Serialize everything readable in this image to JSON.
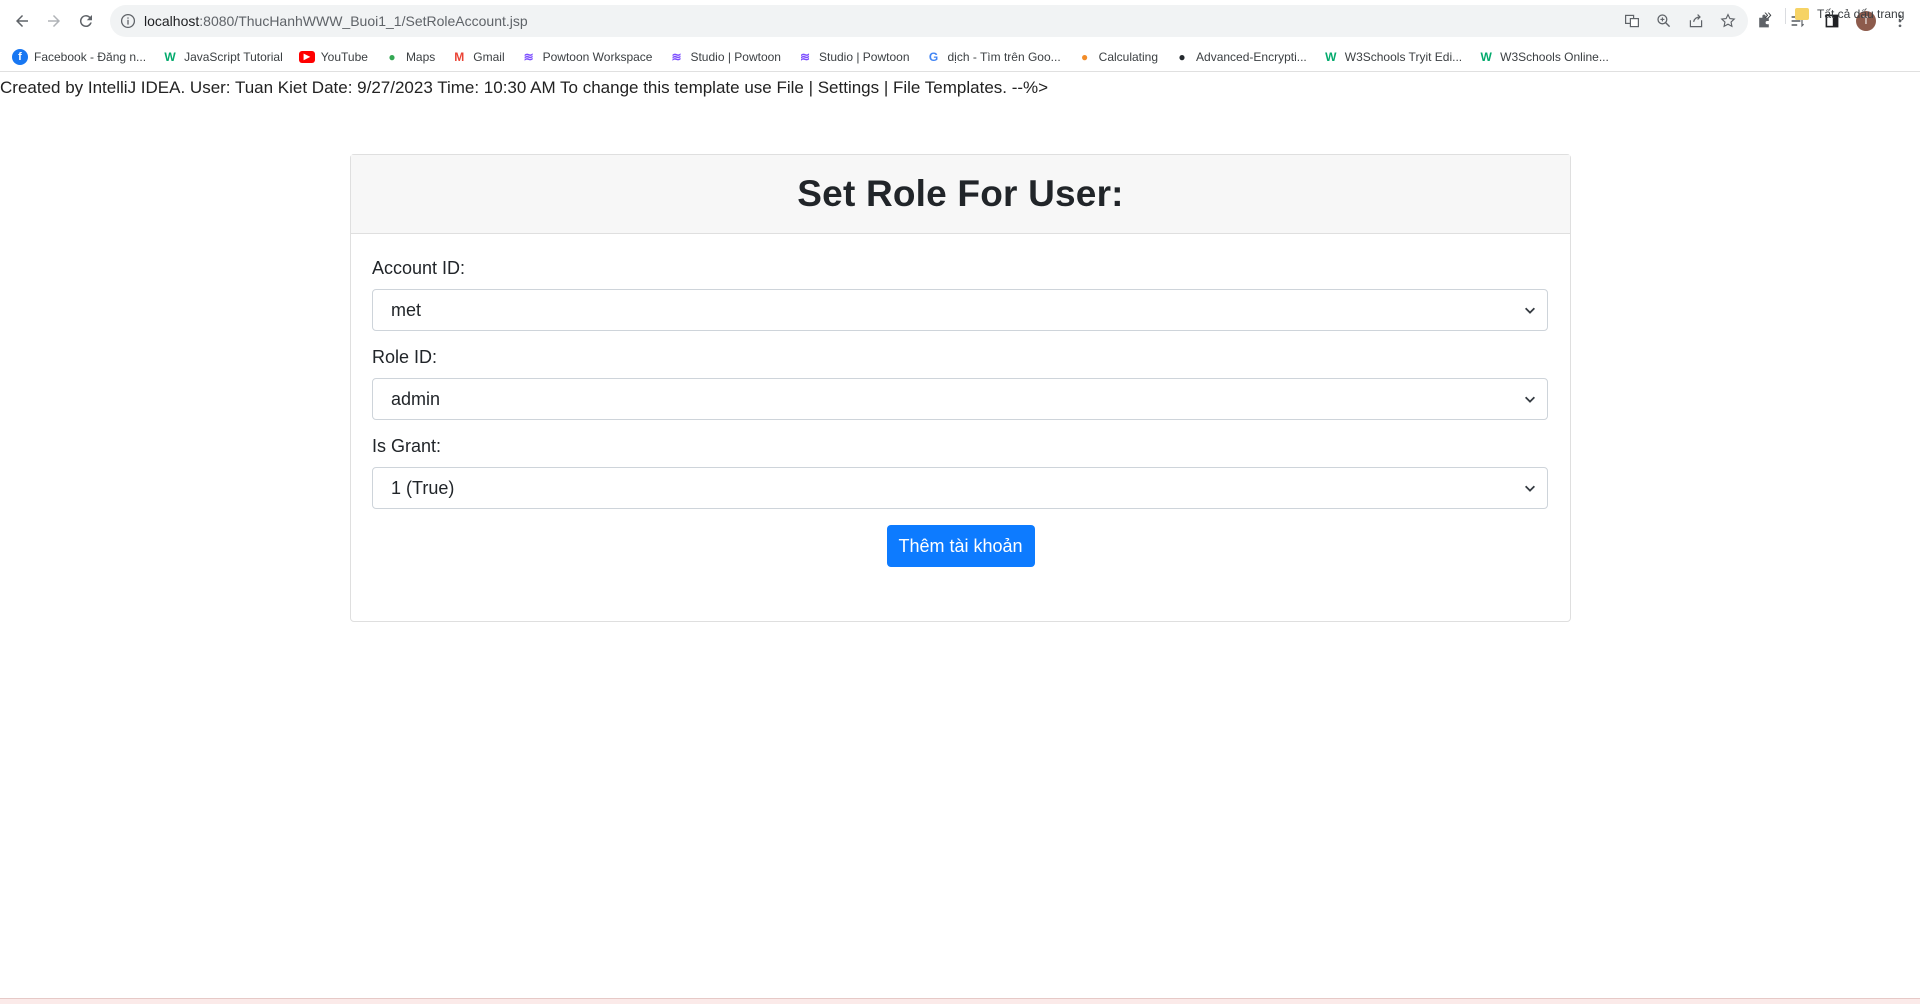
{
  "browser": {
    "url_host": "localhost",
    "url_rest": ":8080/ThucHanhWWW_Buoi1_1/SetRoleAccount.jsp",
    "profile_initial": "T",
    "bookmarks": [
      {
        "label": "Facebook - Đăng n...",
        "icon": "facebook-icon",
        "color": "#1877f2"
      },
      {
        "label": "JavaScript Tutorial",
        "icon": "w3schools-icon",
        "color": "#04aa6d"
      },
      {
        "label": "YouTube",
        "icon": "youtube-icon",
        "color": "#ff0000"
      },
      {
        "label": "Maps",
        "icon": "maps-icon",
        "color": "#34a853"
      },
      {
        "label": "Gmail",
        "icon": "gmail-icon",
        "color": "#ea4335"
      },
      {
        "label": "Powtoon Workspace",
        "icon": "powtoon-icon",
        "color": "#7b4dff"
      },
      {
        "label": "Studio | Powtoon",
        "icon": "powtoon-icon",
        "color": "#7b4dff"
      },
      {
        "label": "Studio | Powtoon",
        "icon": "powtoon-icon",
        "color": "#7b4dff"
      },
      {
        "label": "dịch - Tìm trên Goo...",
        "icon": "google-icon",
        "color": "#4285f4"
      },
      {
        "label": "Calculating",
        "icon": "pumpkin-icon",
        "color": "#f28c28"
      },
      {
        "label": "Advanced-Encrypti...",
        "icon": "github-icon",
        "color": "#24292e"
      },
      {
        "label": "W3Schools Tryit Edi...",
        "icon": "w3schools-icon",
        "color": "#04aa6d"
      },
      {
        "label": "W3Schools Online...",
        "icon": "w3schools-icon",
        "color": "#04aa6d"
      }
    ],
    "more_bookmarks": "»",
    "all_bookmarks": "Tất cả dấu trang"
  },
  "page": {
    "comment": "Created by IntelliJ IDEA. User: Tuan Kiet Date: 9/27/2023 Time: 10:30 AM To change this template use File | Settings | File Templates. --%>",
    "title": "Set Role For User:",
    "fields": {
      "account": {
        "label": "Account ID:",
        "value": "met"
      },
      "role": {
        "label": "Role ID:",
        "value": "admin"
      },
      "grant": {
        "label": "Is Grant:",
        "value": "1 (True)"
      }
    },
    "submit_label": "Thêm tài khoản",
    "accent_color": "#0d7bff"
  }
}
